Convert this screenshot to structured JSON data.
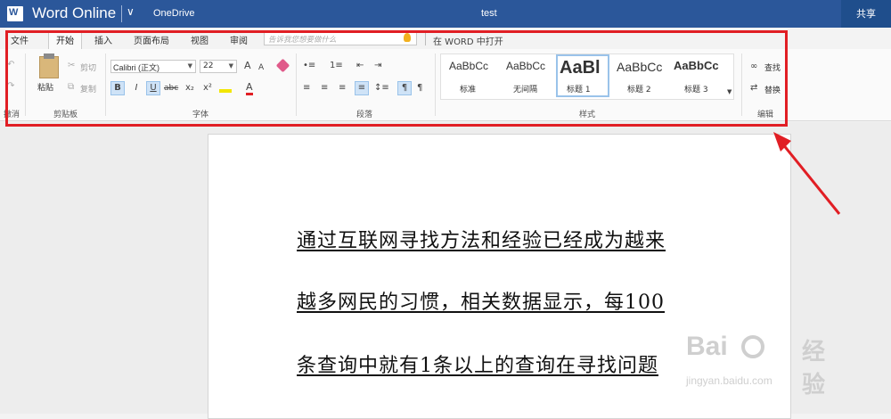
{
  "titlebar": {
    "app_name": "Word Online",
    "onedrive": "OneDrive",
    "doc_title": "test",
    "share": "共享"
  },
  "tabs": [
    {
      "label": "文件"
    },
    {
      "label": "开始"
    },
    {
      "label": "插入"
    },
    {
      "label": "页面布局"
    },
    {
      "label": "视图"
    },
    {
      "label": "审阅"
    }
  ],
  "tellme": {
    "placeholder": "告诉我您想要做什么"
  },
  "open_in_word": "在 WORD 中打开",
  "ribbon": {
    "clipboard": {
      "paste": "粘贴",
      "cut": "剪切",
      "copy": "复制",
      "label": "剪贴板"
    },
    "undo_label": "撤消",
    "font": {
      "name": "Calibri (正文)",
      "size": "22",
      "label": "字体",
      "bold": "B",
      "italic": "I",
      "underline": "U",
      "strike": "abc",
      "subscript": "x₂",
      "superscript": "x²",
      "font_color": "A",
      "grow": "A",
      "shrink": "A"
    },
    "paragraph": {
      "label": "段落"
    },
    "styles": {
      "label": "样式",
      "items": [
        {
          "preview": "AaBbCc",
          "name": "标准"
        },
        {
          "preview": "AaBbCc",
          "name": "无间隔"
        },
        {
          "preview": "AaBl",
          "name": "标题 1"
        },
        {
          "preview": "AaBbCc",
          "name": "标题 2"
        },
        {
          "preview": "AaBbCc",
          "name": "标题 3"
        }
      ]
    },
    "editing": {
      "find": "查找",
      "replace": "替换",
      "label": "编辑"
    }
  },
  "document": {
    "lines": [
      "通过互联网寻找方法和经验已经成为越来",
      "越多网民的习惯，相关数据显示，每100",
      "条查询中就有1条以上的查询在寻找问题"
    ]
  },
  "watermark": {
    "brand": "Bai",
    "brand_cn": "经验",
    "url": "jingyan.baidu.com"
  },
  "colors": {
    "titlebar": "#2b579a",
    "highlight": "#e11e24"
  }
}
